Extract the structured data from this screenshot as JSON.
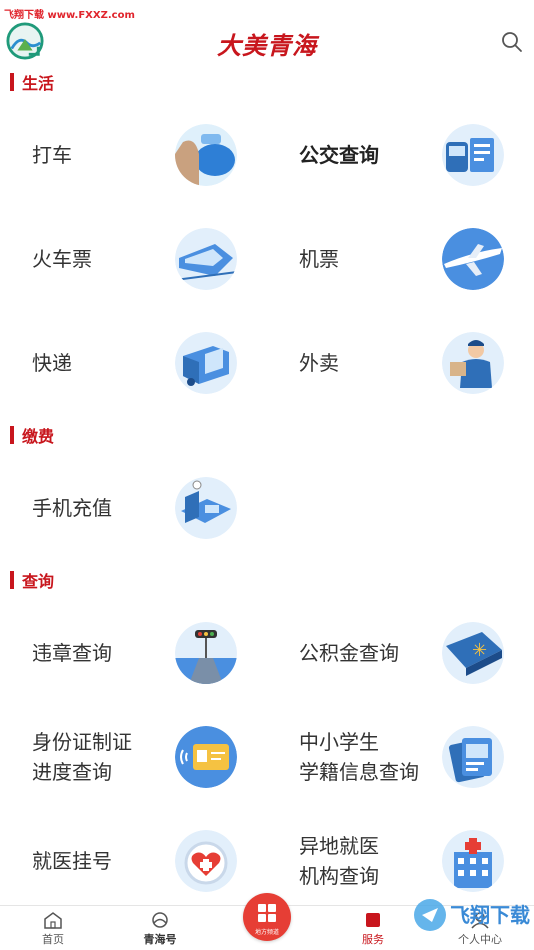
{
  "watermark_top": "飞翔下载 www.FXXZ.com",
  "header": {
    "brand": "大美青海"
  },
  "sections": [
    {
      "title": "生活"
    },
    {
      "title": "缴费"
    },
    {
      "title": "查询"
    }
  ],
  "tiles": {
    "taxi": "打车",
    "bus": "公交查询",
    "train": "火车票",
    "flight": "机票",
    "express": "快递",
    "takeout": "外卖",
    "recharge": "手机充值",
    "violation": "违章查询",
    "fund": "公积金查询",
    "idcard_1": "身份证制证",
    "idcard_2": "进度查询",
    "student_1": "中小学生",
    "student_2": "学籍信息查询",
    "hospital": "就医挂号",
    "remote_1": "异地就医",
    "remote_2": "机构查询"
  },
  "bottom_nav": {
    "home": "首页",
    "qinghai": "青海号",
    "center": "地方频道",
    "service": "服务",
    "me": "个人中心"
  },
  "watermark_bottom": "飞翔下载",
  "colors": {
    "accent": "#c8161d",
    "icon_blue": "#4a8fe0"
  }
}
